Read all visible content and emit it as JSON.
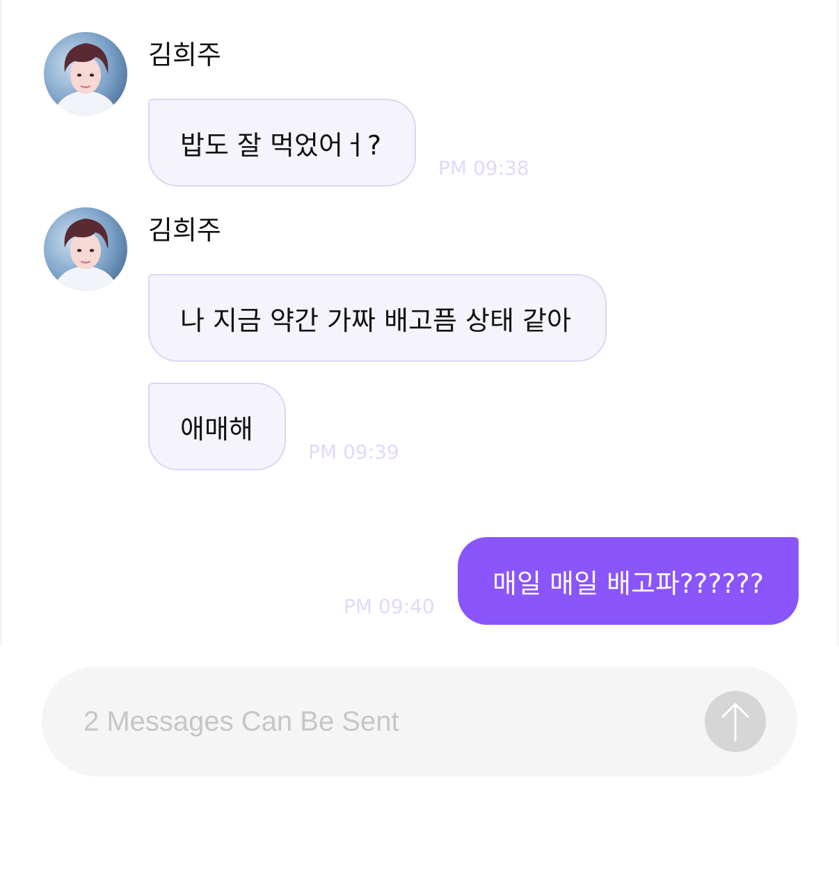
{
  "colors": {
    "incoming_bubble": "#f5f3fb",
    "incoming_border": "#ded5f5",
    "outgoing_bubble": "#8a55fb",
    "timestamp": "#e2d8fb",
    "composer_bg": "#f5f5f5",
    "send_button": "#d6d6d6"
  },
  "messages": [
    {
      "sender": "김희주",
      "text": "밥도 잘 먹었어ㅓ?",
      "time": "PM 09:38",
      "avatar_icon": "profile-photo"
    },
    {
      "sender": "김희주",
      "text": "나 지금 약간 가짜 배고픔 상태 같아",
      "avatar_icon": "profile-photo"
    },
    {
      "text": "애매해",
      "time": "PM 09:39"
    },
    {
      "text": "매일 매일 배고파??????",
      "time": "PM 09:40",
      "outgoing": true
    }
  ],
  "composer": {
    "placeholder": "2 Messages Can Be Sent",
    "send_icon": "arrow-up-icon"
  }
}
